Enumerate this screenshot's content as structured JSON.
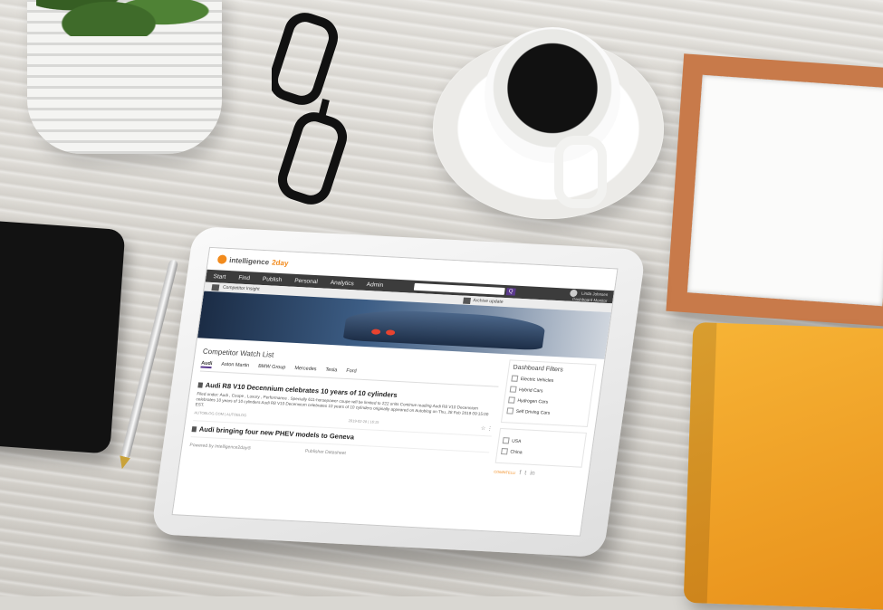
{
  "app": {
    "logo_prefix": "intelligence",
    "logo_suffix": "2day"
  },
  "navbar": {
    "items": [
      "Start",
      "Find",
      "Publish",
      "Personal",
      "Analytics",
      "Admin"
    ],
    "search_button": "Q",
    "user_name": "Linda Johnsen",
    "user_role": "Dashboard Monitor"
  },
  "subbar": {
    "left_label": "Competitor Insight",
    "right_label": "Archive update"
  },
  "watchlist": {
    "title": "Competitor Watch List",
    "tabs": [
      "Audi",
      "Aston Martin",
      "BMW Group",
      "Mercedes",
      "Tesla",
      "Ford"
    ],
    "articles": [
      {
        "title": "Audi R8 V10 Decennium celebrates 10 years of 10 cylinders",
        "body": "Filed under: Audi , Coupe , Luxury , Performance . Specially 611-horsepower coupe will be limited to 222 units Continue reading Audi R8 V10 Decennium celebrates 10 years of 10 cylinders Audi R8 V10 Decennium celebrates 10 years of 10 cylinders originally appeared on Autoblog on Thu, 28 Feb 2019 09:15:00 EST.",
        "source": "AUTOBLOG.COM | AUTOBLOG",
        "date": "2019-02-28 | 16:15"
      },
      {
        "title": "Audi bringing four new PHEV models to Geneva",
        "body": "",
        "source": "",
        "date": ""
      }
    ]
  },
  "footer": {
    "powered_by": "Powered by Intelligence2day®",
    "publisher": "Publisher Datasheet"
  },
  "filters": {
    "title": "Dashboard Filters",
    "items": [
      "Electric Vehicles",
      "Hybrid Cars",
      "Hydrogen Cars",
      "Self Driving Cars"
    ],
    "regions": [
      "USA",
      "China"
    ],
    "badge": "COMINTELLI",
    "social": [
      "f",
      "t",
      "in"
    ]
  }
}
